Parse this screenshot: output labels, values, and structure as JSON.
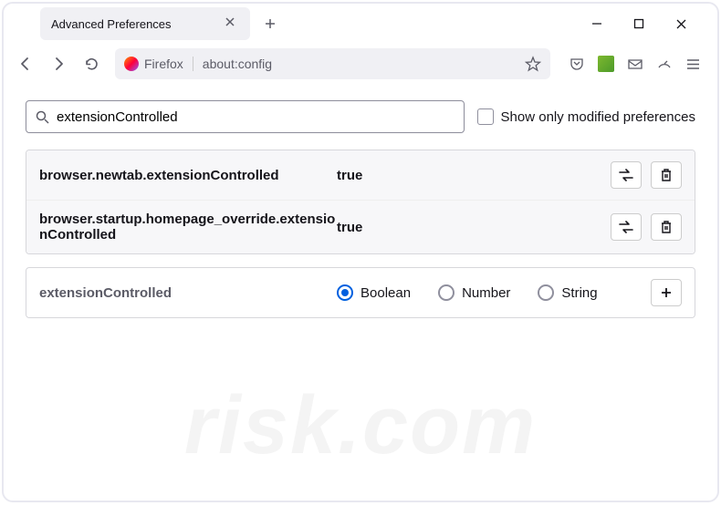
{
  "titlebar": {
    "tab_title": "Advanced Preferences"
  },
  "navbar": {
    "identity_label": "Firefox",
    "url": "about:config"
  },
  "search": {
    "value": "extensionControlled",
    "modified_label": "Show only modified preferences"
  },
  "prefs": [
    {
      "name": "browser.newtab.extensionControlled",
      "value": "true"
    },
    {
      "name": "browser.startup.homepage_override.extensionControlled",
      "value": "true"
    }
  ],
  "new_pref": {
    "name": "extensionControlled",
    "types": [
      {
        "label": "Boolean",
        "checked": true
      },
      {
        "label": "Number",
        "checked": false
      },
      {
        "label": "String",
        "checked": false
      }
    ]
  },
  "watermark": "risk.com"
}
